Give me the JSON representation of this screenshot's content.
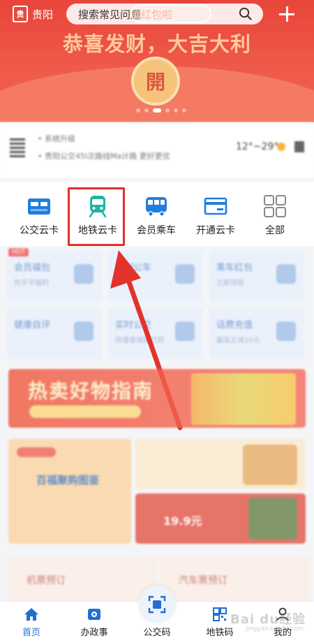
{
  "top_bar": {
    "city": "贵阳",
    "search_placeholder": "搜索常见问题",
    "search_overlay": "发红包啦"
  },
  "banner": {
    "slogan": "恭喜发财，大吉大利",
    "coin_text": "開",
    "page_count": 6,
    "active_page": 3
  },
  "info_card": {
    "line1": "• 系统升级",
    "line2": "• 贵阳公交45l次路线Ma计路 更好更优",
    "temperature": "12°~29°"
  },
  "nav_icons": [
    {
      "label": "公交云卡",
      "icon": "bus-card-icon"
    },
    {
      "label": "地铁云卡",
      "icon": "subway-train-icon",
      "highlighted": true
    },
    {
      "label": "会员乘车",
      "icon": "bus-icon"
    },
    {
      "label": "开通云卡",
      "icon": "credit-card-icon"
    },
    {
      "label": "全部",
      "icon": "grid-icon"
    }
  ],
  "service_grid": [
    {
      "title": "会员福包",
      "sub": "热乎乎福利",
      "tag": "HOT"
    },
    {
      "title": "定制公车",
      "sub": ""
    },
    {
      "title": "乘车红包",
      "sub": "立即领取"
    },
    {
      "title": "健康自评",
      "sub": ""
    },
    {
      "title": "实时公交",
      "sub": "快速查询随时到"
    },
    {
      "title": "话费充值",
      "sub": "最高立减20元"
    }
  ],
  "promo": {
    "title": "热卖好物指南"
  },
  "cards": {
    "card1_title": "百福聚购图鉴",
    "card3_price": "19.9元"
  },
  "tickets": [
    {
      "label": "机票预订"
    },
    {
      "label": "汽车票预订"
    }
  ],
  "tab_bar": [
    {
      "label": "首页",
      "icon": "home-icon",
      "active": true
    },
    {
      "label": "办政事",
      "icon": "document-icon"
    },
    {
      "label": "公交码",
      "icon": "scan-code-icon"
    },
    {
      "label": "地铁码",
      "icon": "qr-code-icon"
    },
    {
      "label": "我的",
      "icon": "user-icon"
    }
  ],
  "watermark": {
    "main": "Bai du经验",
    "sub": "jingyan.baidu.com"
  },
  "colors": {
    "brand_red": "#e8453a",
    "highlight_border": "#e0302a",
    "nav_blue": "#1f7ee0",
    "subway_teal": "#22b3a3",
    "active_tab": "#1f6fd6"
  }
}
